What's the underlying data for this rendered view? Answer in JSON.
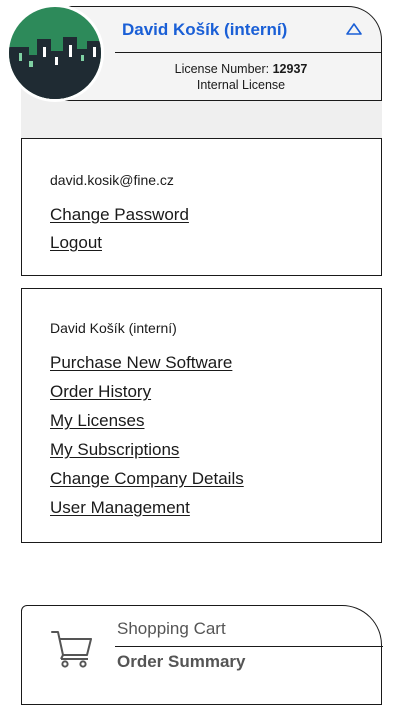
{
  "profile": {
    "user_name": "David Košík (interní)",
    "license_number_label": "License Number:",
    "license_number": "12937",
    "license_type": "Internal License"
  },
  "account_box": {
    "email": "david.kosik@fine.cz",
    "links": [
      "Change Password",
      "Logout"
    ]
  },
  "menu_box": {
    "heading": "David Košík (interní)",
    "links": [
      "Purchase New Software",
      "Order History",
      "My Licenses",
      "My Subscriptions",
      "Change Company Details",
      "User Management"
    ]
  },
  "cart": {
    "title": "Shopping Cart",
    "summary": "Order Summary"
  },
  "colors": {
    "accent": "#1a5fd6",
    "avatar_bg": "#2d8a5a",
    "building_dark": "#1f2b33"
  },
  "icons": {
    "caret": "caret-up-icon",
    "cart": "shopping-cart-icon"
  }
}
